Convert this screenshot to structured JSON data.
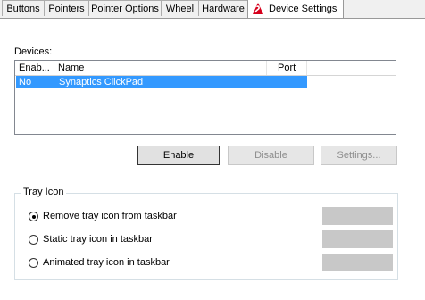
{
  "tabs": [
    {
      "label": "Buttons"
    },
    {
      "label": "Pointers"
    },
    {
      "label": "Pointer Options"
    },
    {
      "label": "Wheel"
    },
    {
      "label": "Hardware"
    },
    {
      "label": "Device Settings",
      "active": true,
      "icon": "synaptics-logo-icon"
    }
  ],
  "devices": {
    "label": "Devices:",
    "columns": [
      "Enab...",
      "Name",
      "Port"
    ],
    "rows": [
      {
        "enabled": "No",
        "name": "Synaptics ClickPad",
        "port": "",
        "selected": true
      }
    ]
  },
  "buttons": {
    "enable": "Enable",
    "disable": "Disable",
    "settings": "Settings..."
  },
  "tray": {
    "group_label": "Tray Icon",
    "options": [
      {
        "label": "Remove tray icon from taskbar",
        "checked": true
      },
      {
        "label": "Static tray icon in taskbar",
        "checked": false
      },
      {
        "label": "Animated tray icon in taskbar",
        "checked": false
      }
    ]
  },
  "colors": {
    "selection": "#3399ff",
    "logo_red": "#d6001c",
    "icon_placeholder": "#c8c8c8"
  }
}
